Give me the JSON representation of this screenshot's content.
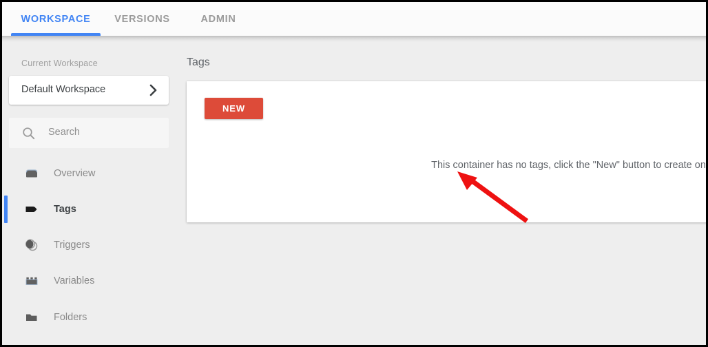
{
  "window": {
    "border_color": "#000000"
  },
  "tabs": {
    "items": [
      {
        "label": "WORKSPACE",
        "active": true
      },
      {
        "label": "VERSIONS",
        "active": false
      },
      {
        "label": "ADMIN",
        "active": false
      }
    ],
    "active_color": "#4285f4",
    "inactive_color": "#9b9b9b"
  },
  "sidebar": {
    "current_workspace_label": "Current Workspace",
    "workspace_name": "Default Workspace",
    "workspace_chevron_icon": "chevron-right-icon",
    "search": {
      "placeholder": "Search",
      "value": "",
      "icon": "search-icon"
    },
    "items": [
      {
        "label": "Overview",
        "icon": "overview-icon",
        "active": false
      },
      {
        "label": "Tags",
        "icon": "tag-icon",
        "active": true
      },
      {
        "label": "Triggers",
        "icon": "trigger-icon",
        "active": false
      },
      {
        "label": "Variables",
        "icon": "variables-icon",
        "active": false
      },
      {
        "label": "Folders",
        "icon": "folder-icon",
        "active": false
      }
    ],
    "active_indicator_color": "#4285f4"
  },
  "main": {
    "page_title": "Tags",
    "new_button_label": "NEW",
    "new_button_color": "#dd4b39",
    "empty_state_message": "This container has no tags, click the \"New\" button to create one."
  },
  "annotation": {
    "arrow_color": "#ee1111",
    "points_to": "new-button"
  }
}
